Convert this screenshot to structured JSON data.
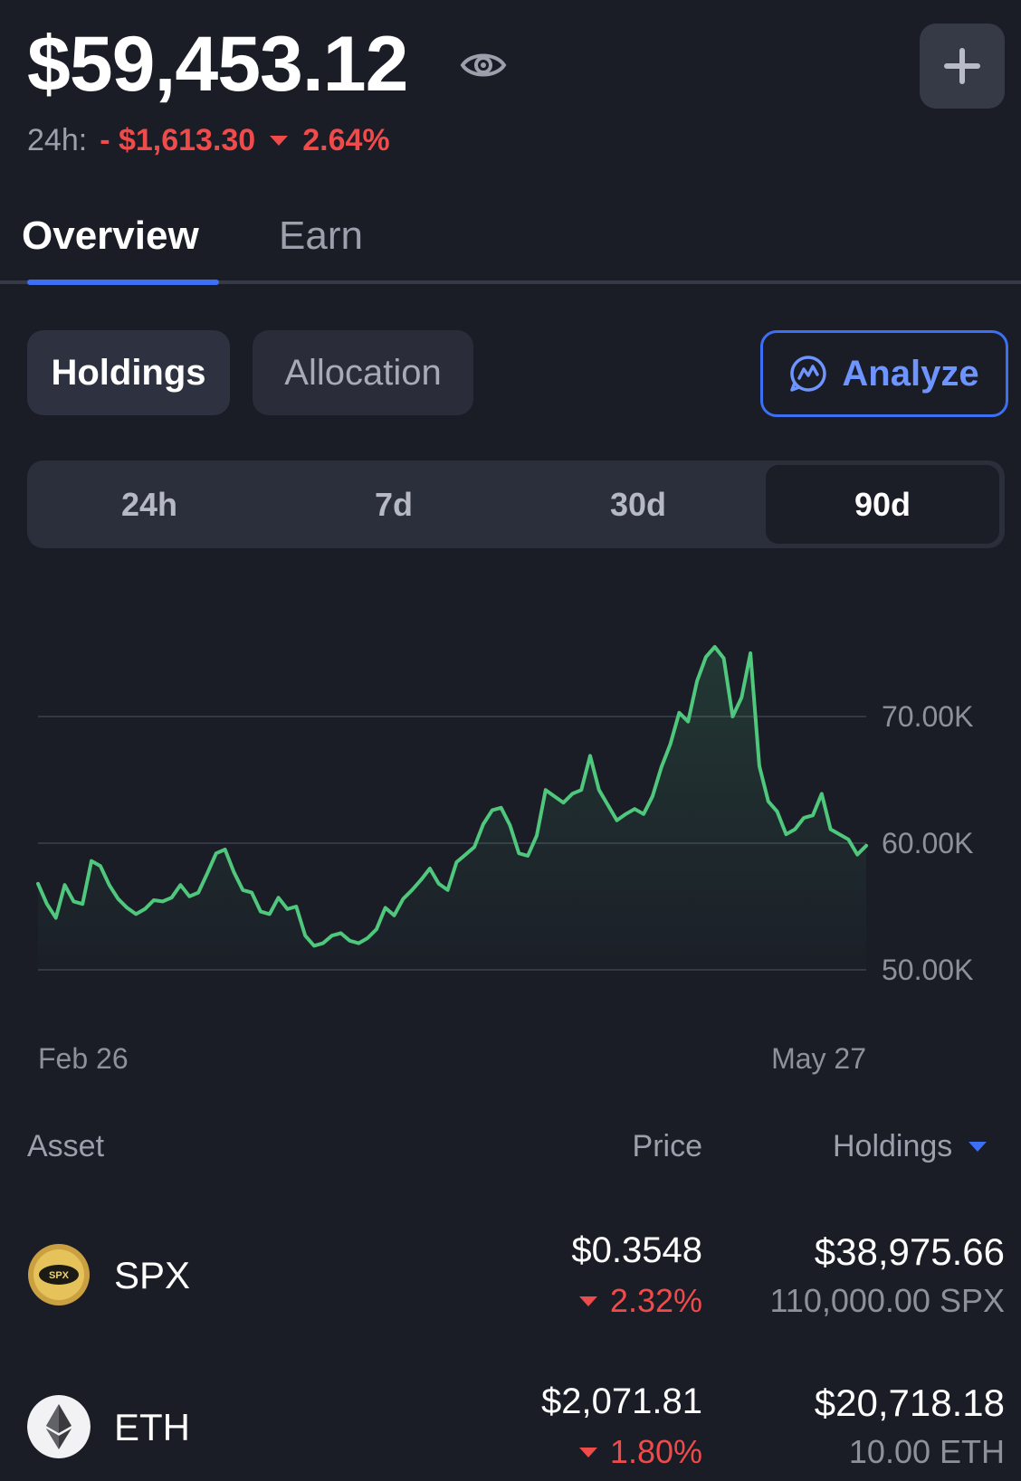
{
  "header": {
    "balance": "$59,453.12",
    "change_label": "24h:",
    "change_value": "- $1,613.30",
    "change_percent": "2.64%",
    "eye_icon": "eye-icon",
    "add_icon": "plus-icon"
  },
  "tabs": [
    {
      "label": "Overview",
      "active": true
    },
    {
      "label": "Earn",
      "active": false
    }
  ],
  "toggle": {
    "holdings": "Holdings",
    "allocation": "Allocation",
    "analyze": "Analyze",
    "analyze_icon": "analyze-chart-icon"
  },
  "periods": [
    {
      "label": "24h",
      "active": false
    },
    {
      "label": "7d",
      "active": false
    },
    {
      "label": "30d",
      "active": false
    },
    {
      "label": "90d",
      "active": true
    }
  ],
  "chart_data": {
    "type": "area",
    "x_labels": [
      "Feb 26",
      "May 27"
    ],
    "yticks": [
      "50.00K",
      "60.00K",
      "70.00K"
    ],
    "ytick_values": [
      50000,
      60000,
      70000
    ],
    "ylim": [
      48000,
      78000
    ],
    "line_color": "#4fc77c",
    "grid": true,
    "values": [
      56800,
      55200,
      54100,
      56700,
      55400,
      55200,
      58600,
      58200,
      56700,
      55600,
      54900,
      54400,
      54800,
      55500,
      55400,
      55700,
      56700,
      55800,
      56100,
      57600,
      59200,
      59500,
      57700,
      56300,
      56100,
      54600,
      54400,
      55700,
      54800,
      55000,
      52700,
      51900,
      52100,
      52700,
      52900,
      52300,
      52100,
      52500,
      53200,
      54900,
      54300,
      55600,
      56300,
      57100,
      58000,
      56800,
      56300,
      58500,
      59100,
      59700,
      61500,
      62600,
      62800,
      61400,
      59200,
      59000,
      60600,
      64200,
      63700,
      63200,
      63900,
      64200,
      66900,
      64200,
      63000,
      61800,
      62300,
      62700,
      62300,
      63700,
      66000,
      67800,
      70300,
      69600,
      72800,
      74700,
      75500,
      74600,
      70000,
      71500,
      75000,
      66100,
      63300,
      62500,
      60700,
      61100,
      62000,
      62200,
      63900,
      61100,
      60700,
      60300,
      59100,
      59800
    ]
  },
  "table": {
    "headers": {
      "asset": "Asset",
      "price": "Price",
      "holdings": "Holdings"
    },
    "rows": [
      {
        "symbol": "SPX",
        "icon": "spx-coin-icon",
        "price": "$0.3548",
        "change": "2.32%",
        "value": "$38,975.66",
        "quantity": "110,000.00 SPX"
      },
      {
        "symbol": "ETH",
        "icon": "eth-coin-icon",
        "price": "$2,071.81",
        "change": "1.80%",
        "value": "$20,718.18",
        "quantity": "10.00 ETH"
      }
    ]
  }
}
